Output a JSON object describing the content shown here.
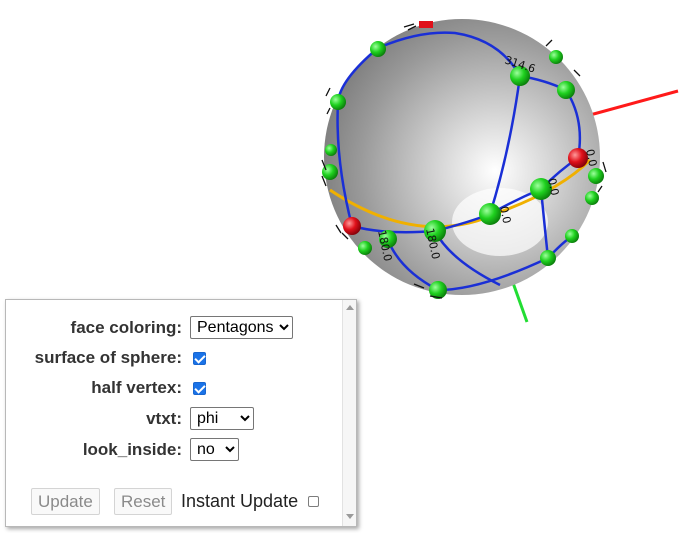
{
  "controls": {
    "face_coloring": {
      "label": "face coloring:",
      "value": "Pentagons",
      "options": [
        "Pentagons"
      ]
    },
    "surface_of_sphere": {
      "label": "surface of sphere:",
      "checked": true
    },
    "half_vertex": {
      "label": "half vertex:",
      "checked": true
    },
    "vtxt": {
      "label": "vtxt:",
      "value": "phi",
      "options": [
        "phi"
      ]
    },
    "look_inside": {
      "label": "look_inside:",
      "value": "no",
      "options": [
        "no"
      ]
    }
  },
  "buttons": {
    "update": "Update",
    "reset": "Reset"
  },
  "instant_update": {
    "label": "Instant Update",
    "checked": false
  },
  "scene": {
    "vertex_labels": [
      "314.6",
      "0.0",
      "0.0",
      "180.0",
      "0.0",
      "180.0"
    ],
    "colors": {
      "axis_x": "#ff1a1a",
      "axis_y": "#22dd33",
      "edges": "#1a2fd6",
      "equator": "#f0b000",
      "vertex_green": "#1fd11f",
      "vertex_red": "#e0101a",
      "sphere": "#a9a9a9"
    }
  }
}
